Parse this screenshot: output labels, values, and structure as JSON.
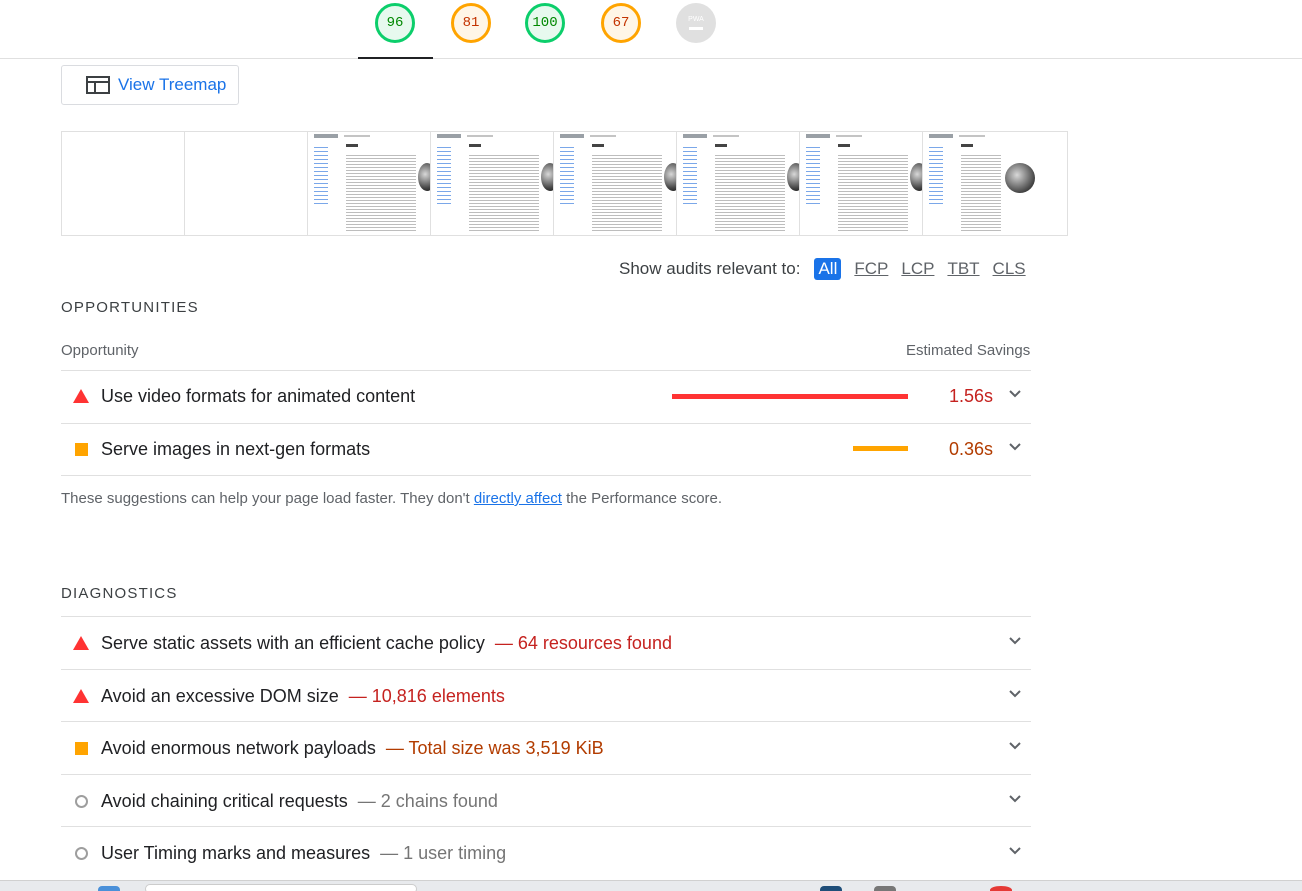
{
  "scores": [
    {
      "value": "96",
      "status": "pass",
      "name": "performance"
    },
    {
      "value": "81",
      "status": "average",
      "name": "accessibility"
    },
    {
      "value": "100",
      "status": "pass",
      "name": "best-practices"
    },
    {
      "value": "67",
      "status": "average",
      "name": "seo"
    },
    {
      "value": "PWA",
      "status": "pwa",
      "name": "pwa"
    }
  ],
  "treemap": {
    "label": "View Treemap",
    "icon": "treemap-icon"
  },
  "filter": {
    "label": "Show audits relevant to:",
    "options": [
      "All",
      "FCP",
      "LCP",
      "TBT",
      "CLS"
    ],
    "selected": "All"
  },
  "opportunities": {
    "title": "OPPORTUNITIES",
    "col_left": "Opportunity",
    "col_right": "Estimated Savings",
    "items": [
      {
        "title": "Use video formats for animated content",
        "savings": "1.56s",
        "severity": "fail",
        "bar_fraction": 1.0
      },
      {
        "title": "Serve images in next-gen formats",
        "savings": "0.36s",
        "severity": "average",
        "bar_fraction": 0.23
      }
    ],
    "note_before": "These suggestions can help your page load faster. They don't ",
    "note_link": "directly affect",
    "note_after": " the Performance score."
  },
  "diagnostics": {
    "title": "DIAGNOSTICS",
    "items": [
      {
        "title": "Serve static assets with an efficient cache policy",
        "display": "— 64 resources found",
        "severity": "fail"
      },
      {
        "title": "Avoid an excessive DOM size",
        "display": "— 10,816 elements",
        "severity": "fail"
      },
      {
        "title": "Avoid enormous network payloads",
        "display": "— Total size was 3,519 KiB",
        "severity": "average"
      },
      {
        "title": "Avoid chaining critical requests",
        "display": "— 2 chains found",
        "severity": "info"
      },
      {
        "title": "User Timing marks and measures",
        "display": "— 1 user timing",
        "severity": "info"
      }
    ]
  },
  "colors": {
    "fail": "#ff3333",
    "average": "#ffa400",
    "pass": "#0cce6b",
    "accent": "#1a73e8"
  }
}
